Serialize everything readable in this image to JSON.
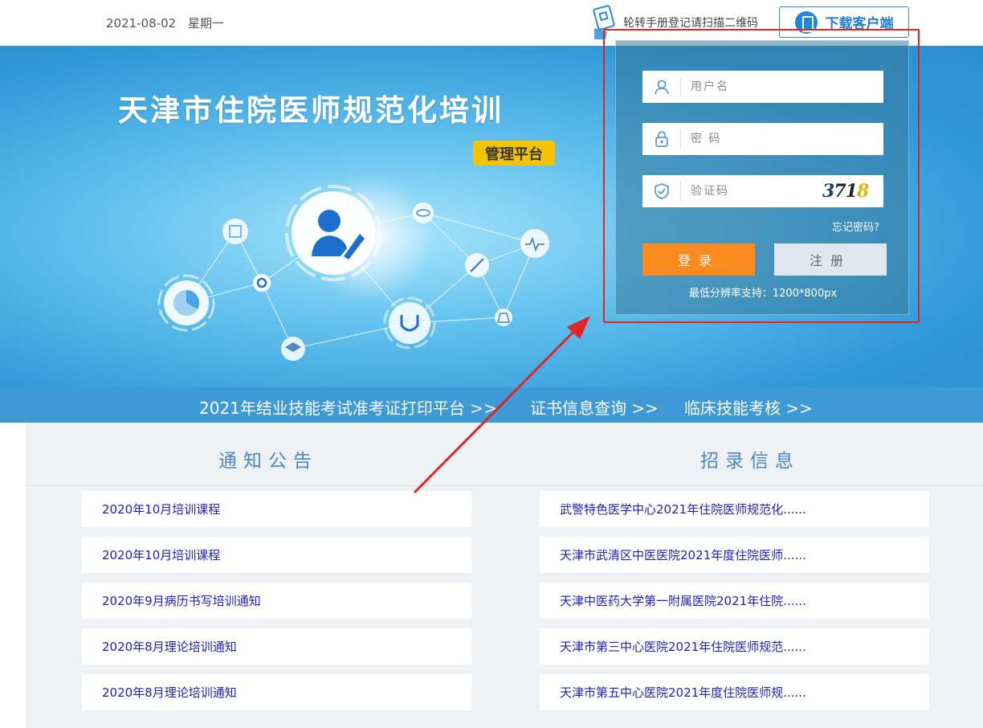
{
  "header": {
    "date": "2021-08-02",
    "weekday": "星期一",
    "qr_text": "轮转手册登记请扫描二维码",
    "download_label": "下载客户端"
  },
  "banner": {
    "title": "天津市住院医师规范化培训",
    "badge": "管理平台"
  },
  "login": {
    "username_placeholder": "用户名",
    "password_placeholder": "密 码",
    "captcha_placeholder": "验证码",
    "captcha": {
      "d1": "3",
      "d2": "7",
      "d3": "1",
      "d4": "8"
    },
    "forgot": "忘记密码?",
    "login_label": "登录",
    "register_label": "注册",
    "resolution_note": "最低分辨率支持：1200*800px",
    "highlight_color": "#e32424",
    "login_color": "#fb8a1e"
  },
  "links": {
    "exam_print": "2021年结业技能考试准考证打印平台 >>",
    "cert_query": "证书信息查询 >>",
    "clinical_exam": "临床技能考核 >>"
  },
  "notices": {
    "title": "通知公告",
    "items": [
      "2020年10月培训课程",
      "2020年10月培训课程",
      "2020年9月病历书写培训通知",
      "2020年8月理论培训通知",
      "2020年8月理论培训通知"
    ]
  },
  "recruit": {
    "title": "招录信息",
    "items": [
      "武警特色医学中心2021年住院医师规范化......",
      "天津市武清区中医医院2021年度住院医师......",
      "天津中医药大学第一附属医院2021年住院......",
      "天津市第三中心医院2021年住院医师规范......",
      "天津市第五中心医院2021年度住院医师规......"
    ]
  },
  "icons": [
    "qr-hand-icon",
    "phone-icon",
    "user-icon",
    "lock-icon",
    "shield-icon",
    "doctor-icon",
    "pie-chart-icon",
    "gear-icon",
    "graduation-cap-icon",
    "stethoscope-icon",
    "eye-icon",
    "heartbeat-icon",
    "syringe-icon",
    "building-icon",
    "flask-icon"
  ]
}
